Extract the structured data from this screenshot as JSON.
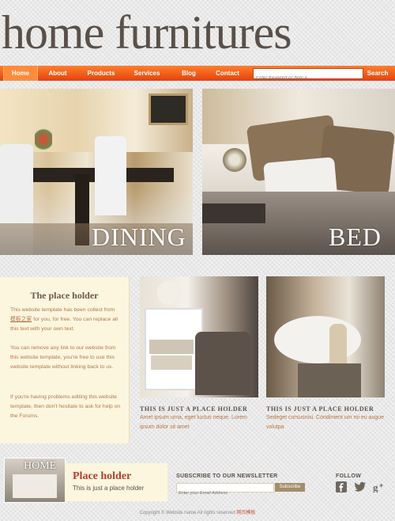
{
  "brand": {
    "logo_text": "home furnitures"
  },
  "nav": {
    "items": [
      {
        "label": "Home"
      },
      {
        "label": "About"
      },
      {
        "label": "Products"
      },
      {
        "label": "Services"
      },
      {
        "label": "Blog"
      },
      {
        "label": "Contact"
      }
    ],
    "search_placeholder": "Enter Keyword or Item #",
    "search_button": "Search"
  },
  "hero": {
    "left_label": "DINING",
    "right_label": "BED"
  },
  "side": {
    "title": "The place holder",
    "p1_before": "This website template has been collect from ",
    "p1_link": "模板之家",
    "p1_after": " for you, for free. You can replace all this text with your own text.",
    "p2": "You can remove any link to our website from this website template, you're free to use this website template without linking back to us.",
    "p3": "If you're having problems editing this website template, then don't hesitate to ask for help on the Forums."
  },
  "cards": [
    {
      "title": "THIS IS JUST A PLACE HOLDER",
      "text": "Amet ipsum urna, eget luctus neque. Lorem ipsum dolor sit amet"
    },
    {
      "title": "THIS IS JUST A PLACE HOLDER",
      "text": "Sedeget cursusnisi. Condiment um mi eu augue volutpa"
    }
  ],
  "footer": {
    "thumb_label": "HOME",
    "box_title": "Place holder",
    "box_sub": "This is just a place holder",
    "newsletter_title": "SUBSCRIBE TO OUR NEWSLETTER",
    "newsletter_placeholder": "Enter your Email Address",
    "subscribe_label": "Subscribe",
    "follow_title": "FOLLOW",
    "social_icons": [
      "facebook-icon",
      "twitter-icon",
      "google-plus-icon"
    ],
    "copyright_before": "Copyright © Website name All rights reserved ",
    "copyright_link": "网页模板"
  },
  "colors": {
    "nav_orange": "#f2591b",
    "accent_red": "#b3402a",
    "text_brown": "#b4764a"
  }
}
